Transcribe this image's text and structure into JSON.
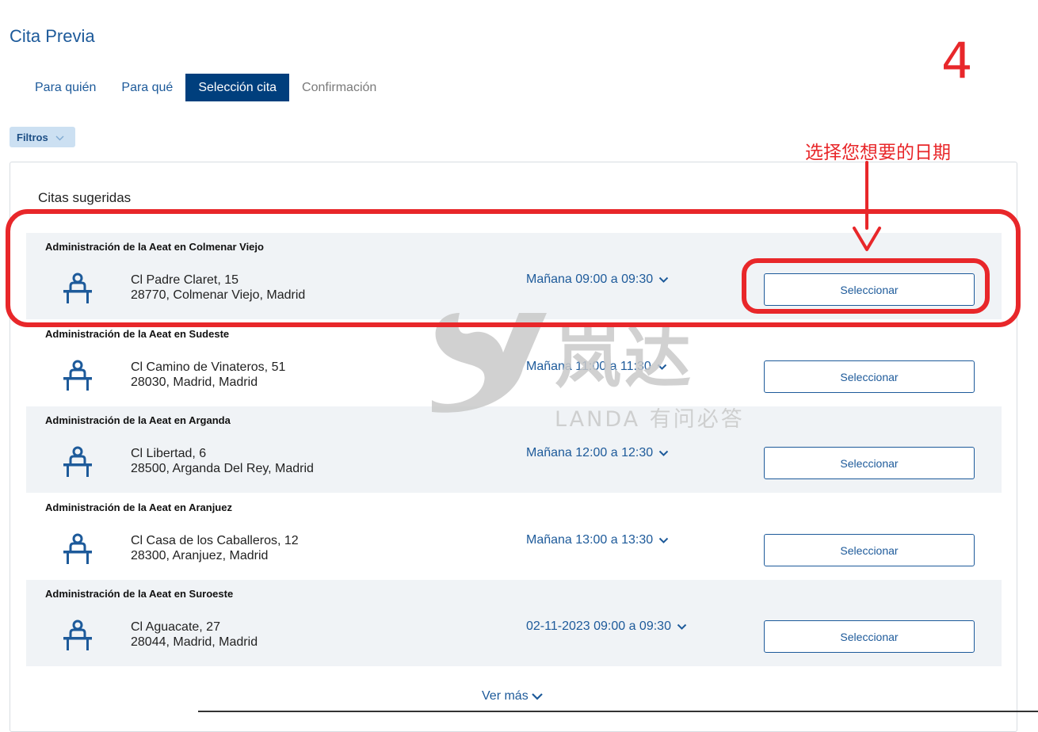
{
  "page": {
    "title": "Cita Previa"
  },
  "tabs": [
    {
      "label": "Para quién"
    },
    {
      "label": "Para qué"
    },
    {
      "label": "Selección cita"
    },
    {
      "label": "Confirmación"
    }
  ],
  "filters": {
    "label": "Filtros"
  },
  "suggested": {
    "title": "Citas sugeridas",
    "select_label": "Seleccionar",
    "offices": [
      {
        "name": "Administración de la Aeat en Colmenar Viejo",
        "address_line1": "Cl Padre Claret, 15",
        "address_line2": "28770, Colmenar Viejo, Madrid",
        "time": "Mañana 09:00 a 09:30"
      },
      {
        "name": "Administración de la Aeat en Sudeste",
        "address_line1": "Cl Camino de Vinateros, 51",
        "address_line2": "28030, Madrid, Madrid",
        "time": "Mañana 11:00 a 11:30"
      },
      {
        "name": "Administración de la Aeat en Arganda",
        "address_line1": "Cl Libertad, 6",
        "address_line2": "28500, Arganda Del Rey, Madrid",
        "time": "Mañana 12:00 a 12:30"
      },
      {
        "name": "Administración de la Aeat en Aranjuez",
        "address_line1": "Cl Casa de los Caballeros, 12",
        "address_line2": "28300, Aranjuez, Madrid",
        "time": "Mañana 13:00 a 13:30"
      },
      {
        "name": "Administración de la Aeat en Suroeste",
        "address_line1": "Cl Aguacate, 27",
        "address_line2": "28044, Madrid, Madrid",
        "time": "02-11-2023 09:00 a 09:30"
      }
    ],
    "more_label": "Ver más"
  },
  "annotation": {
    "step_number": "4",
    "hint": "选择您想要的日期",
    "color": "#e8272a"
  },
  "watermark": {
    "brand_cn": "岚达",
    "tagline": "LANDA 有问必答"
  },
  "colors": {
    "primary": "#1d5a9a",
    "active_tab": "#003f7d",
    "row_shade": "#f0f3f6",
    "filter_bg": "#cce0f2"
  }
}
